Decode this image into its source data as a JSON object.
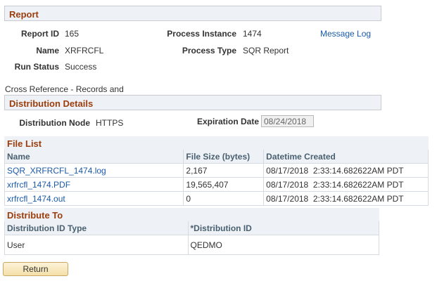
{
  "report": {
    "section_title": "Report",
    "report_id_label": "Report ID",
    "report_id": "165",
    "process_instance_label": "Process Instance",
    "process_instance": "1474",
    "message_log_link": "Message Log",
    "name_label": "Name",
    "name": "XRFRCFL",
    "process_type_label": "Process Type",
    "process_type": "SQR Report",
    "run_status_label": "Run Status",
    "run_status": "Success",
    "description": "Cross Reference - Records and"
  },
  "distribution": {
    "section_title": "Distribution Details",
    "node_label": "Distribution Node",
    "node": "HTTPS",
    "expiration_label": "Expiration Date",
    "expiration_date": "08/24/2018"
  },
  "file_list": {
    "title": "File List",
    "headers": [
      "Name",
      "File Size (bytes)",
      "Datetime Created"
    ],
    "rows": [
      {
        "name": "SQR_XRFRCFL_1474.log",
        "size": "2,167",
        "created": "08/17/2018  2:33:14.682622AM PDT"
      },
      {
        "name": "xrfrcfl_1474.PDF",
        "size": "19,565,407",
        "created": "08/17/2018  2:33:14.682622AM PDT"
      },
      {
        "name": "xrfrcfl_1474.out",
        "size": "0",
        "created": "08/17/2018  2:33:14.682622AM PDT"
      }
    ]
  },
  "distribute_to": {
    "title": "Distribute To",
    "headers": [
      "Distribution ID Type",
      "*Distribution ID"
    ],
    "rows": [
      {
        "type": "User",
        "id": "QEDMO"
      }
    ]
  },
  "actions": {
    "return_label": "Return"
  }
}
